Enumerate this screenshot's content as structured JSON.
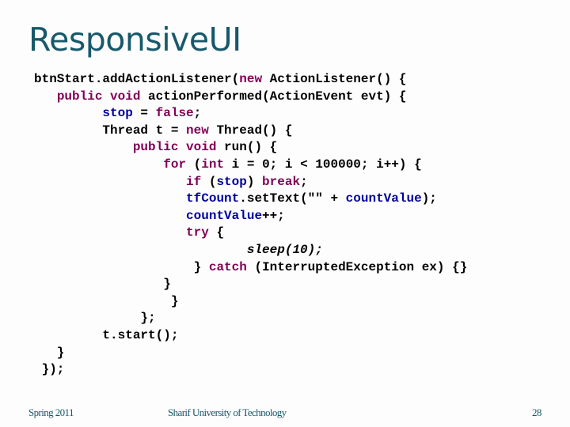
{
  "slide": {
    "title": "ResponsiveUI",
    "code_lines": [
      [
        {
          "t": "btnStart.addActionListener(",
          "c": ""
        },
        {
          "t": "new",
          "c": "kw"
        },
        {
          "t": " ActionListener() {",
          "c": ""
        }
      ],
      [
        {
          "t": "   ",
          "c": ""
        },
        {
          "t": "public void",
          "c": "kw"
        },
        {
          "t": " actionPerformed(ActionEvent evt) {",
          "c": ""
        }
      ],
      [
        {
          "t": "         ",
          "c": ""
        },
        {
          "t": "stop",
          "c": "fld"
        },
        {
          "t": " = ",
          "c": ""
        },
        {
          "t": "false",
          "c": "kw"
        },
        {
          "t": ";",
          "c": ""
        }
      ],
      [
        {
          "t": "         Thread t = ",
          "c": ""
        },
        {
          "t": "new",
          "c": "kw"
        },
        {
          "t": " Thread() {",
          "c": ""
        }
      ],
      [
        {
          "t": "             ",
          "c": ""
        },
        {
          "t": "public void",
          "c": "kw"
        },
        {
          "t": " run() {",
          "c": ""
        }
      ],
      [
        {
          "t": "                 ",
          "c": ""
        },
        {
          "t": "for",
          "c": "kw"
        },
        {
          "t": " (",
          "c": ""
        },
        {
          "t": "int",
          "c": "kw"
        },
        {
          "t": " i = 0; i < 100000; i++) {",
          "c": ""
        }
      ],
      [
        {
          "t": "                    ",
          "c": ""
        },
        {
          "t": "if",
          "c": "kw"
        },
        {
          "t": " (",
          "c": ""
        },
        {
          "t": "stop",
          "c": "fld"
        },
        {
          "t": ") ",
          "c": ""
        },
        {
          "t": "break",
          "c": "kw"
        },
        {
          "t": ";",
          "c": ""
        }
      ],
      [
        {
          "t": "                    ",
          "c": ""
        },
        {
          "t": "tfCount",
          "c": "fld"
        },
        {
          "t": ".setText(\"\" + ",
          "c": ""
        },
        {
          "t": "countValue",
          "c": "fld"
        },
        {
          "t": ");",
          "c": ""
        }
      ],
      [
        {
          "t": "                    ",
          "c": ""
        },
        {
          "t": "countValue",
          "c": "fld"
        },
        {
          "t": "++;",
          "c": ""
        }
      ],
      [
        {
          "t": "                    ",
          "c": ""
        },
        {
          "t": "try",
          "c": "kw"
        },
        {
          "t": " {",
          "c": ""
        }
      ],
      [
        {
          "t": "                            ",
          "c": ""
        },
        {
          "t": "sleep(10);",
          "c": "it"
        }
      ],
      [
        {
          "t": "                     } ",
          "c": ""
        },
        {
          "t": "catch",
          "c": "kw"
        },
        {
          "t": " (InterruptedException ex) {}",
          "c": ""
        }
      ],
      [
        {
          "t": "                 }",
          "c": ""
        }
      ],
      [
        {
          "t": "                  }",
          "c": ""
        }
      ],
      [
        {
          "t": "              };",
          "c": ""
        }
      ],
      [
        {
          "t": "         t.start();",
          "c": ""
        }
      ],
      [
        {
          "t": "   }",
          "c": ""
        }
      ],
      [
        {
          "t": " });",
          "c": ""
        }
      ]
    ]
  },
  "footer": {
    "left": "Spring 2011",
    "center": "Sharif University of Technology",
    "page_number": "28"
  },
  "colors": {
    "title": "#17596b",
    "keyword": "#7f0055",
    "field": "#0000a0"
  }
}
